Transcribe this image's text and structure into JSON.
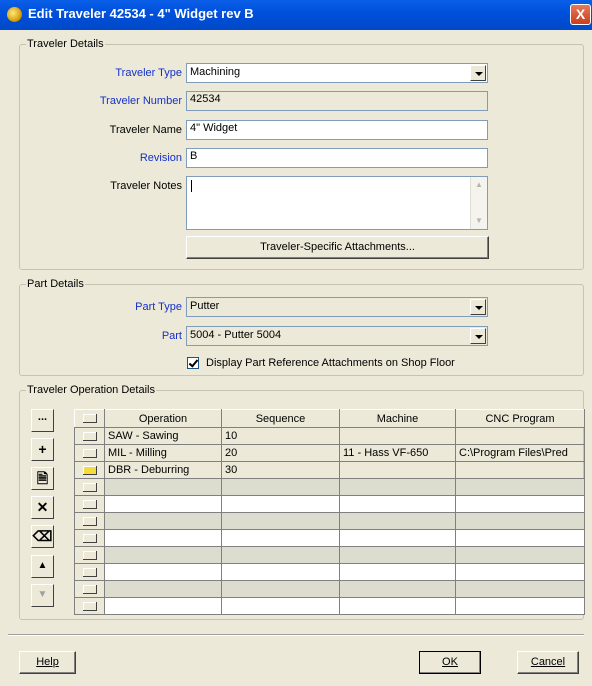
{
  "window": {
    "title": "Edit Traveler 42534 - 4\" Widget rev B",
    "close_label": "X"
  },
  "traveler_details": {
    "legend": "Traveler Details",
    "type_label": "Traveler Type",
    "type_value": "Machining",
    "number_label": "Traveler Number",
    "number_value": "42534",
    "name_label": "Traveler Name",
    "name_value": "4\" Widget",
    "revision_label": "Revision",
    "revision_value": "B",
    "notes_label": "Traveler Notes",
    "notes_value": "",
    "attachments_button": "Traveler-Specific Attachments..."
  },
  "part_details": {
    "legend": "Part Details",
    "part_type_label": "Part Type",
    "part_type_value": "Putter",
    "part_label": "Part",
    "part_value": "5004 - Putter 5004",
    "display_checkbox_label": "Display Part Reference Attachments on Shop Floor",
    "display_checkbox_checked": true
  },
  "operation_details": {
    "legend": "Traveler Operation Details",
    "side_buttons": [
      {
        "name": "ellipsis-button",
        "glyph": "..."
      },
      {
        "name": "add-icon",
        "glyph": "+"
      },
      {
        "name": "document-icon",
        "glyph": "🗎"
      },
      {
        "name": "delete-icon",
        "glyph": "✕"
      },
      {
        "name": "eraser-icon",
        "glyph": "⌫"
      },
      {
        "name": "move-up-icon",
        "glyph": "▲"
      },
      {
        "name": "move-down-icon",
        "glyph": "▼"
      }
    ],
    "columns": [
      "Operation",
      "Sequence",
      "Machine",
      "CNC Program"
    ],
    "rows": [
      {
        "operation": "SAW - Sawing",
        "sequence": "10",
        "machine": "",
        "cnc": ""
      },
      {
        "operation": "MIL - Milling",
        "sequence": "20",
        "machine": "11 - Hass VF-650",
        "cnc": "C:\\Program Files\\Pred"
      },
      {
        "operation": "DBR - Deburring",
        "sequence": "30",
        "machine": "",
        "cnc": ""
      }
    ],
    "current_row": 2,
    "empty_rows": 8
  },
  "footer": {
    "help": "Help",
    "ok": "OK",
    "cancel": "Cancel"
  }
}
